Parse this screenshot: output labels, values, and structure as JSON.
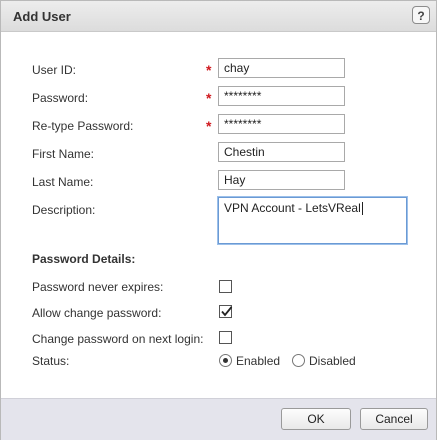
{
  "dialog": {
    "title": "Add User",
    "help_label": "?"
  },
  "form": {
    "required_mark": "*",
    "user_id": {
      "label": "User ID:",
      "value": "chay"
    },
    "password": {
      "label": "Password:",
      "value": "********"
    },
    "retype_password": {
      "label": "Re-type Password:",
      "value": "********"
    },
    "first_name": {
      "label": "First Name:",
      "value": "Chestin"
    },
    "last_name": {
      "label": "Last Name:",
      "value": "Hay"
    },
    "description": {
      "label": "Description:",
      "value": "VPN Account - LetsVReal"
    }
  },
  "password_details": {
    "heading": "Password Details:",
    "never_expires": {
      "label": "Password never expires:",
      "checked": false
    },
    "allow_change": {
      "label": "Allow change password:",
      "checked": true
    },
    "change_next_login": {
      "label": "Change password on next login:",
      "checked": false
    },
    "status": {
      "label": "Status:",
      "options": [
        {
          "label": "Enabled",
          "selected": true
        },
        {
          "label": "Disabled",
          "selected": false
        }
      ]
    }
  },
  "footer": {
    "ok_label": "OK",
    "cancel_label": "Cancel"
  },
  "icons": {
    "help": "help-icon",
    "check": "checkmark-icon"
  }
}
